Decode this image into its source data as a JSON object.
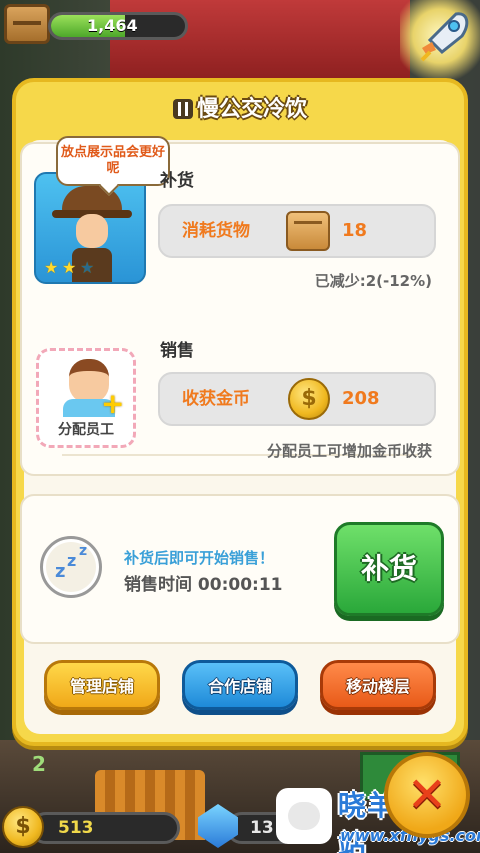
{
  "hud": {
    "top_counter": "1,464",
    "coins": "513",
    "gems": "13"
  },
  "panel": {
    "title": "慢公交冷饮"
  },
  "staff_bubble": "放点展示品会更好呢",
  "restock": {
    "title": "补货",
    "consume_label": "消耗货物",
    "consume_value": "18",
    "reduced_note": "已减少:2(-12%)"
  },
  "sales": {
    "title": "销售",
    "income_label": "收获金币",
    "income_value": "208",
    "assign_label": "分配员工",
    "assign_note": "分配员工可增加金币收获"
  },
  "status": {
    "hint": "补货后即可开始销售！",
    "sales_time": "销售时间 00:00:11",
    "restock_button": "补货"
  },
  "buttons": {
    "manage": "管理店铺",
    "coop": "合作店铺",
    "move": "移动楼层"
  },
  "floor_number": "2",
  "watermark": {
    "title": "晓羊下载站",
    "url": "www.xfhygs.com"
  },
  "colors": {
    "panel_yellow": "#f6d84a",
    "accent_orange": "#f07a1e",
    "restock_green": "#2aa83a",
    "hint_blue": "#3aa0d8"
  }
}
